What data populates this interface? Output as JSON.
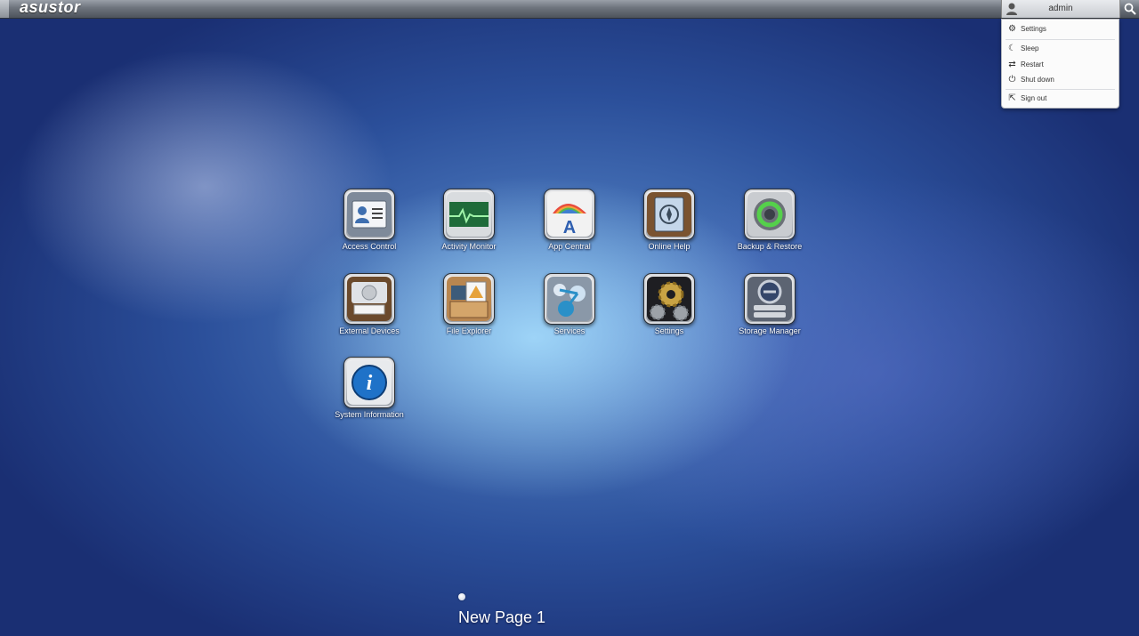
{
  "topbar": {
    "logo": "asustor",
    "user": "admin"
  },
  "user_menu": {
    "items": [
      {
        "label": "Settings",
        "icon": "gear-icon"
      },
      {
        "label": "Sleep",
        "icon": "moon-icon"
      },
      {
        "label": "Restart",
        "icon": "restart-icon"
      },
      {
        "label": "Shut down",
        "icon": "power-icon"
      },
      {
        "label": "Sign out",
        "icon": "sign-out-icon"
      }
    ]
  },
  "apps": [
    {
      "label": "Access Control",
      "icon": "access-control-icon"
    },
    {
      "label": "Activity Monitor",
      "icon": "activity-monitor-icon"
    },
    {
      "label": "App Central",
      "icon": "app-central-icon"
    },
    {
      "label": "Online Help",
      "icon": "online-help-icon"
    },
    {
      "label": "Backup & Restore",
      "icon": "backup-restore-icon"
    },
    {
      "label": "External Devices",
      "icon": "external-devices-icon"
    },
    {
      "label": "File Explorer",
      "icon": "file-explorer-icon"
    },
    {
      "label": "Services",
      "icon": "services-icon"
    },
    {
      "label": "Settings",
      "icon": "settings-icon"
    },
    {
      "label": "Storage Manager",
      "icon": "storage-manager-icon"
    },
    {
      "label": "System Information",
      "icon": "system-information-icon"
    }
  ],
  "pager": {
    "page_label": "New Page 1"
  }
}
